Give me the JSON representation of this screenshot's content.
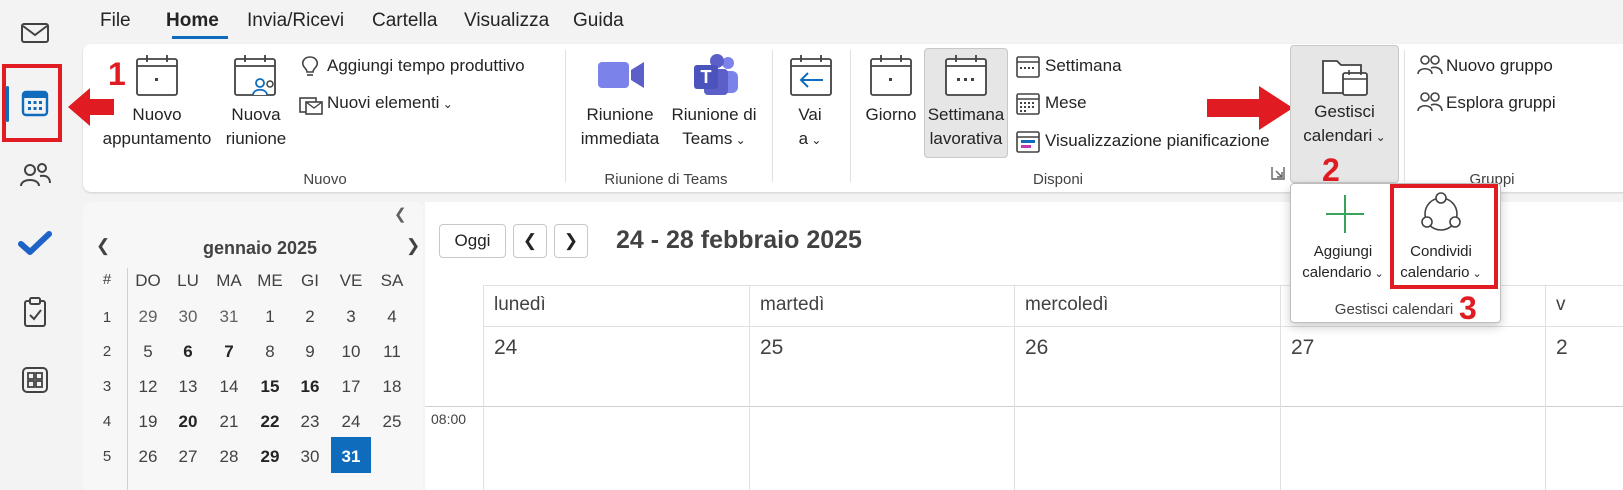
{
  "menu": {
    "tabs": [
      "File",
      "Home",
      "Invia/Ricevi",
      "Cartella",
      "Visualizza",
      "Guida"
    ],
    "active": "Home"
  },
  "ribbon": {
    "nuovo": {
      "group_label": "Nuovo",
      "new_appointment": [
        "Nuovo",
        "appuntamento"
      ],
      "new_meeting": [
        "Nuova",
        "riunione"
      ],
      "add_productive_time": "Aggiungi tempo produttivo",
      "new_items": "Nuovi elementi"
    },
    "teams": {
      "group_label": "Riunione di Teams",
      "instant_meeting": [
        "Riunione",
        "immediata"
      ],
      "teams_meeting": [
        "Riunione di",
        "Teams"
      ]
    },
    "goto": {
      "label": [
        "Vai",
        "a"
      ]
    },
    "disponi": {
      "group_label": "Disponi",
      "day": "Giorno",
      "work_week": [
        "Settimana",
        "lavorativa"
      ],
      "week": "Settimana",
      "month": "Mese",
      "schedule_view": "Visualizzazione pianificazione"
    },
    "manage": {
      "label": [
        "Gestisci",
        "calendari"
      ]
    },
    "groups": {
      "group_label": "Gruppi",
      "new_group": "Nuovo gruppo",
      "browse_groups": "Esplora gruppi"
    }
  },
  "popup": {
    "add_calendar": [
      "Aggiungi",
      "calendario"
    ],
    "share_calendar": [
      "Condividi",
      "calendario"
    ],
    "group_label": "Gestisci calendari"
  },
  "annotations": {
    "n1": "1",
    "n2": "2",
    "n3": "3",
    "arrow_color": "#e11b22"
  },
  "mini_calendar": {
    "month_label": "gennaio 2025",
    "week_header": "#",
    "weekdays": [
      "DO",
      "LU",
      "MA",
      "ME",
      "GI",
      "VE",
      "SA"
    ],
    "weeks": [
      {
        "num": "1",
        "days": [
          "29",
          "30",
          "31",
          "1",
          "2",
          "3",
          "4"
        ]
      },
      {
        "num": "2",
        "days": [
          "5",
          "6",
          "7",
          "8",
          "9",
          "10",
          "11"
        ]
      },
      {
        "num": "3",
        "days": [
          "12",
          "13",
          "14",
          "15",
          "16",
          "17",
          "18"
        ]
      },
      {
        "num": "4",
        "days": [
          "19",
          "20",
          "21",
          "22",
          "23",
          "24",
          "25"
        ]
      },
      {
        "num": "5",
        "days": [
          "26",
          "27",
          "28",
          "29",
          "30",
          "31",
          ""
        ]
      }
    ],
    "selected_day": "31",
    "accent": "#0f6cbd"
  },
  "main_calendar": {
    "today_button": "Oggi",
    "date_range": "24 - 28 febbraio 2025",
    "days": [
      {
        "name": "lunedì",
        "num": "24"
      },
      {
        "name": "martedì",
        "num": "25"
      },
      {
        "name": "mercoledì",
        "num": "26"
      },
      {
        "name": "",
        "num": "27"
      },
      {
        "name": "v",
        "num": "2"
      }
    ],
    "time_slot": "08:00"
  }
}
